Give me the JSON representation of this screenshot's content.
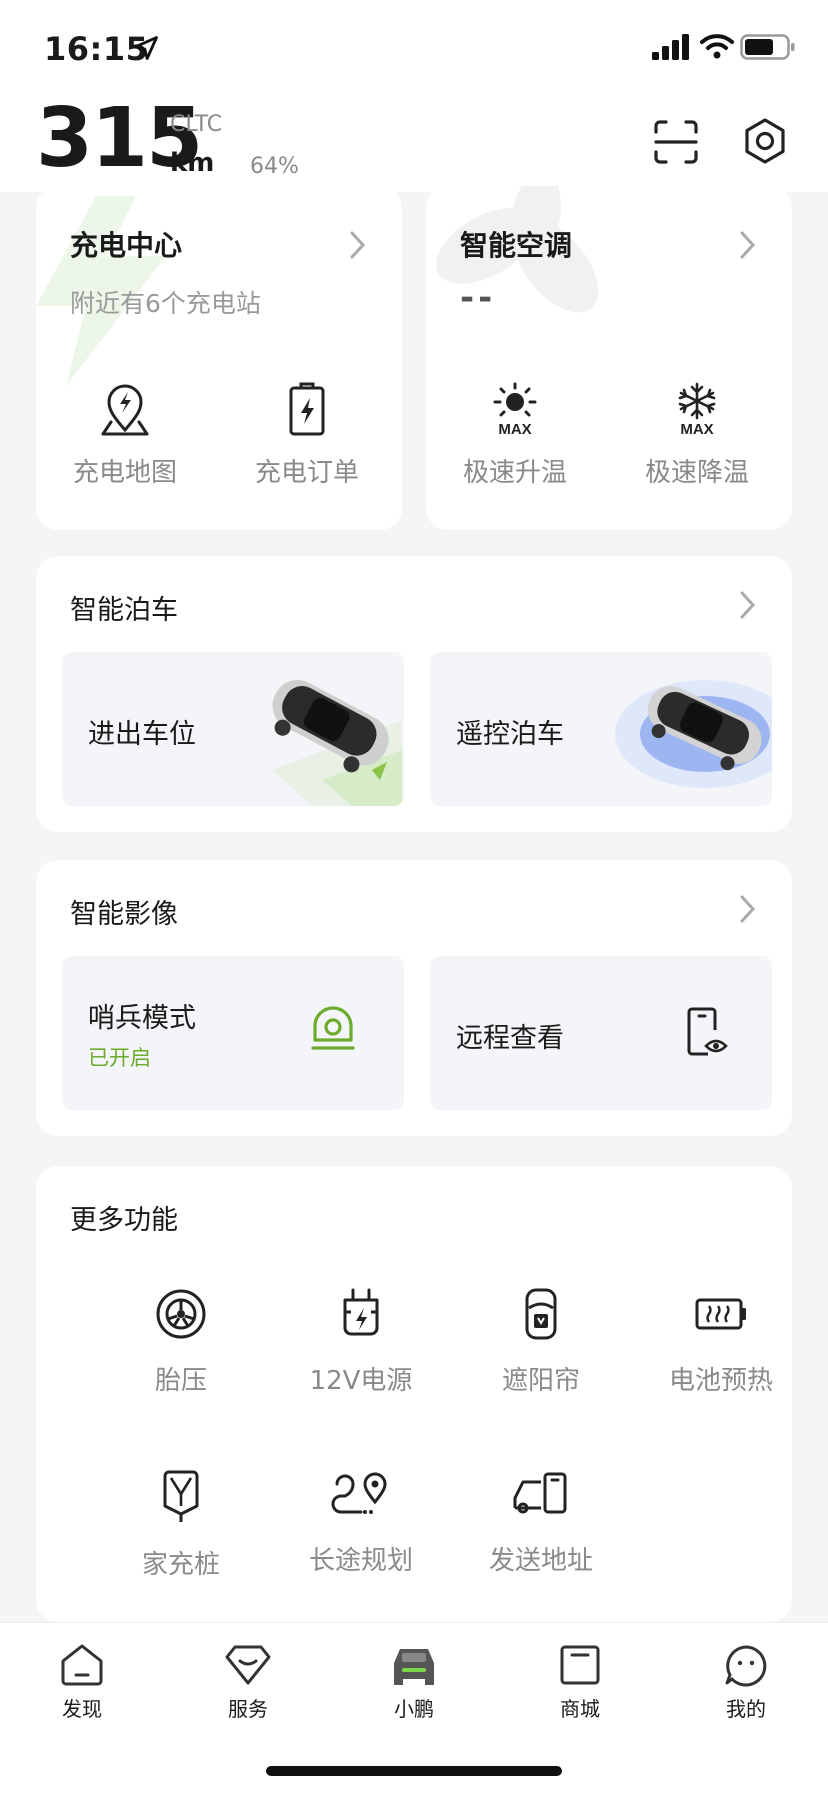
{
  "status_bar": {
    "time": "16:15"
  },
  "header": {
    "range_value": "315",
    "range_standard": "CLTC",
    "range_unit": "km",
    "battery_percent": "64%"
  },
  "charging": {
    "title": "充电中心",
    "subtitle": "附近有6个充电站",
    "actions": [
      {
        "label": "充电地图",
        "icon": "charging-map-icon"
      },
      {
        "label": "充电订单",
        "icon": "charging-order-icon"
      }
    ]
  },
  "climate": {
    "title": "智能空调",
    "value": "--",
    "actions": [
      {
        "label": "极速升温",
        "icon": "sun-max-icon",
        "icon_text": "MAX"
      },
      {
        "label": "极速降温",
        "icon": "snowflake-max-icon",
        "icon_text": "MAX"
      }
    ]
  },
  "parking": {
    "title": "智能泊车",
    "tiles": [
      {
        "label": "进出车位",
        "image": "car-parking-image"
      },
      {
        "label": "遥控泊车",
        "image": "car-remote-image"
      }
    ]
  },
  "imaging": {
    "title": "智能影像",
    "tiles": [
      {
        "label": "哨兵模式",
        "status": "已开启",
        "icon": "sentry-camera-icon"
      },
      {
        "label": "远程查看",
        "icon": "phone-view-icon"
      }
    ]
  },
  "more": {
    "title": "更多功能",
    "items": [
      {
        "label": "胎压",
        "icon": "tire-icon"
      },
      {
        "label": "12V电源",
        "icon": "plug-icon"
      },
      {
        "label": "遮阳帘",
        "icon": "sunshade-icon"
      },
      {
        "label": "电池预热",
        "icon": "battery-heat-icon"
      },
      {
        "label": "家充桩",
        "icon": "home-charger-icon"
      },
      {
        "label": "长途规划",
        "icon": "route-icon"
      },
      {
        "label": "发送地址",
        "icon": "send-address-icon"
      }
    ]
  },
  "tabbar": {
    "tabs": [
      {
        "label": "发现",
        "icon": "discover-icon"
      },
      {
        "label": "服务",
        "icon": "service-icon"
      },
      {
        "label": "小鹏",
        "icon": "car-icon",
        "active": true
      },
      {
        "label": "商城",
        "icon": "store-icon"
      },
      {
        "label": "我的",
        "icon": "profile-icon"
      }
    ]
  },
  "colors": {
    "accent_green": "#6cab2d",
    "background": "#f4f5f7",
    "card": "#ffffff",
    "text_secondary": "#8a8a8a"
  }
}
